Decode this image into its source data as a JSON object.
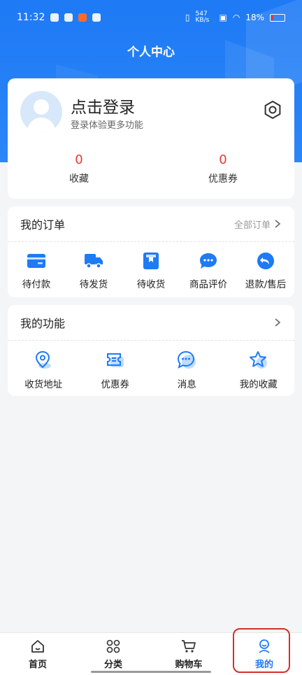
{
  "status_bar": {
    "time": "11:32",
    "net_speed": "547 KB/s",
    "battery": "18%"
  },
  "header": {
    "title": "个人中心"
  },
  "profile": {
    "login_title": "点击登录",
    "login_subtitle": "登录体验更多功能",
    "stats": [
      {
        "value": "0",
        "label": "收藏"
      },
      {
        "value": "0",
        "label": "优惠券"
      }
    ]
  },
  "orders": {
    "title": "我的订单",
    "more_label": "全部订单",
    "items": [
      {
        "label": "待付款",
        "icon": "card-icon"
      },
      {
        "label": "待发货",
        "icon": "truck-icon"
      },
      {
        "label": "待收货",
        "icon": "package-icon"
      },
      {
        "label": "商品评价",
        "icon": "comment-icon"
      },
      {
        "label": "退款/售后",
        "icon": "refund-icon"
      }
    ]
  },
  "functions": {
    "title": "我的功能",
    "items": [
      {
        "label": "收货地址",
        "icon": "location-icon"
      },
      {
        "label": "优惠券",
        "icon": "coupon-icon"
      },
      {
        "label": "消息",
        "icon": "message-icon"
      },
      {
        "label": "我的收藏",
        "icon": "star-icon"
      }
    ]
  },
  "tabbar": {
    "tabs": [
      {
        "label": "首页",
        "icon": "home-icon"
      },
      {
        "label": "分类",
        "icon": "grid-icon"
      },
      {
        "label": "购物车",
        "icon": "cart-icon"
      },
      {
        "label": "我的",
        "icon": "user-icon",
        "active": true
      }
    ]
  },
  "colors": {
    "primary": "#1e7af5",
    "accent_red": "#e53935",
    "highlight": "#d32f2f"
  }
}
